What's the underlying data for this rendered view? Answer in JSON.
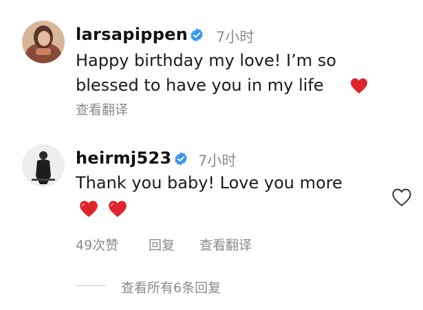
{
  "comments": [
    {
      "username": "larsapippen",
      "time": "7小时",
      "text_line1": "Happy birthday my love! I’m so",
      "text_line2": "blessed to have you in my life",
      "translate_label": "查看翻译"
    },
    {
      "username": "heirmj523",
      "time": "7小时",
      "text_line1": "Thank you baby! Love you more",
      "likes_label": "49次赞",
      "reply_label": "回复",
      "translate_label": "查看翻译",
      "view_replies_label": "查看所有6条回复"
    }
  ],
  "icons": {
    "verified": "verified-badge-icon",
    "heart_emoji": "red-heart-emoji",
    "like": "heart-outline-icon"
  },
  "colors": {
    "verified_blue": "#3797f0",
    "heart_red": "#e0242c",
    "secondary_text": "#8a8a8a"
  }
}
